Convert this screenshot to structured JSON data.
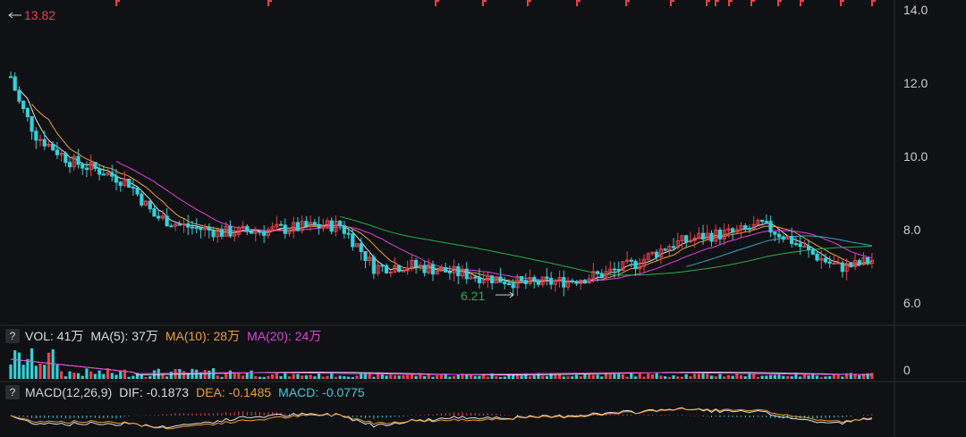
{
  "chart_data": {
    "type": "candlestick",
    "price_axis": {
      "ticks": [
        "14.0",
        "12.0",
        "10.0",
        "8.0",
        "6.0"
      ],
      "ylim": [
        5.8,
        14.1
      ]
    },
    "annotations": {
      "high_label": "13.82",
      "low_label": "6.21"
    },
    "volume_header": {
      "vol": "VOL: 41万",
      "ma5": "MA(5): 37万",
      "ma10": "MA(10): 28万",
      "ma20": "MA(20): 24万"
    },
    "volume_axis_tick": "0",
    "macd_header": {
      "name": "MACD(12,26,9)",
      "dif": "DIF: -0.1873",
      "dea": "DEA: -0.1485",
      "macd": "MACD: -0.0775"
    },
    "colors": {
      "up": "#e8424a",
      "down": "#34d0d8",
      "ma5": "#e0e0e0",
      "ma10": "#f0a030",
      "ma20": "#e040e0",
      "ma60": "#20b050",
      "ma_long": "#3aa0c0"
    }
  },
  "help_symbol": "?"
}
